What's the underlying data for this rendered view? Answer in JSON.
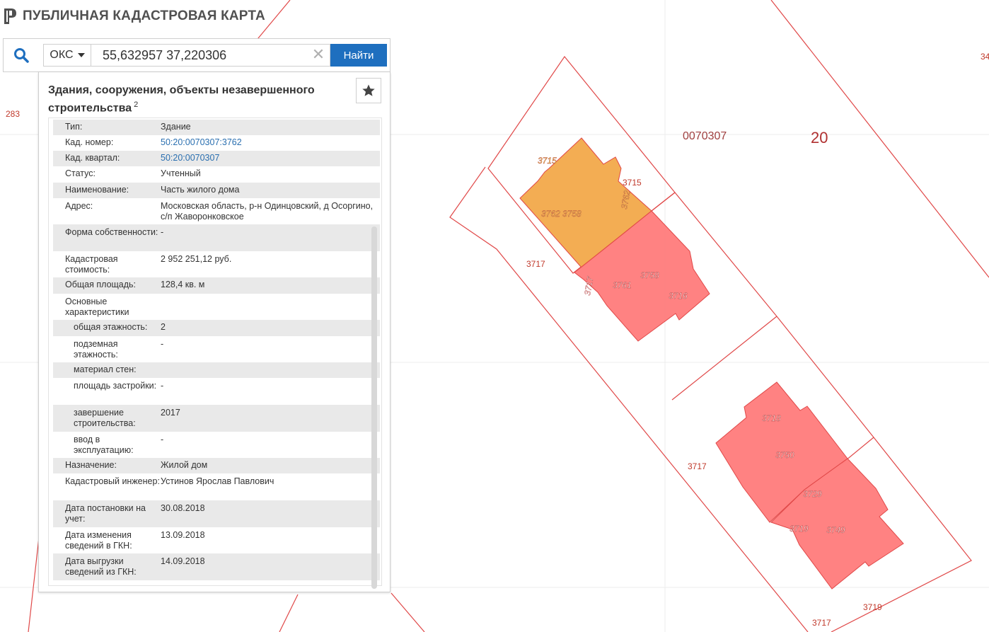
{
  "app": {
    "title": "ПУБЛИЧНАЯ КАДАСТРОВАЯ КАРТА"
  },
  "search": {
    "type_label": "ОКС",
    "query": "55,632957 37,220306",
    "button_label": "Найти"
  },
  "panel": {
    "title": "Здания, сооружения, объекты незавершенного строительства",
    "count": "2",
    "rows": [
      {
        "label": "Тип:",
        "value": "Здание"
      },
      {
        "label": "Кад. номер:",
        "value": "50:20:0070307:3762"
      },
      {
        "label": "Кад. квартал:",
        "value": "50:20:0070307"
      },
      {
        "label": "Статус:",
        "value": "Учтенный"
      },
      {
        "label": "Наименование:",
        "value": "Часть жилого дома"
      },
      {
        "label": "Адрес:",
        "value": "Московская область, р-н Одинцовский, д Осоргино, с/п Жаворонковское"
      },
      {
        "label": "Форма собственности:",
        "value": "-"
      },
      {
        "label": "Кадастровая стоимость:",
        "value": "2 952 251,12 руб."
      },
      {
        "label": "Общая площадь:",
        "value": "128,4 кв. м"
      },
      {
        "label": "Основные характеристики",
        "value": ""
      },
      {
        "label": "общая этажность:",
        "value": "2"
      },
      {
        "label": "подземная этажность:",
        "value": "-"
      },
      {
        "label": "материал стен:",
        "value": ""
      },
      {
        "label": "площадь застройки:",
        "value": "-"
      },
      {
        "label": "завершение строительства:",
        "value": "2017"
      },
      {
        "label": "ввод в эксплуатацию:",
        "value": "-"
      },
      {
        "label": "Назначение:",
        "value": "Жилой дом"
      },
      {
        "label": "Кадастровый инженер:",
        "value": "Устинов Ярослав Павлович"
      },
      {
        "label": "Дата постановки на учет:",
        "value": "30.08.2018"
      },
      {
        "label": "Дата изменения сведений в ГКН:",
        "value": "13.09.2018"
      },
      {
        "label": "Дата выгрузки сведений из ГКН:",
        "value": "14.09.2018"
      }
    ]
  },
  "map": {
    "quarter": "0070307",
    "district": "20",
    "labels": {
      "p283": "283",
      "p34": "34",
      "p3717a": "3717",
      "p3717b": "3717",
      "p3717c": "3717",
      "p3719": "3719",
      "p3715a": "3715",
      "p3715b": "3715",
      "p3762v": "3762",
      "p3762_3758": "3762 3758",
      "p3761": "3761",
      "p3758": "3758",
      "p3716": "3716",
      "p3717v": "3717",
      "p3718": "3718",
      "p3750": "3750",
      "p3729": "3729",
      "p3719b": "3719",
      "p3749": "3749"
    }
  },
  "colors": {
    "brand_text": "#505050",
    "accent": "#1e6fbf",
    "parcel_line": "#e04848",
    "building_fill": "#ff7b7b",
    "selected_fill": "#f2a94a"
  }
}
